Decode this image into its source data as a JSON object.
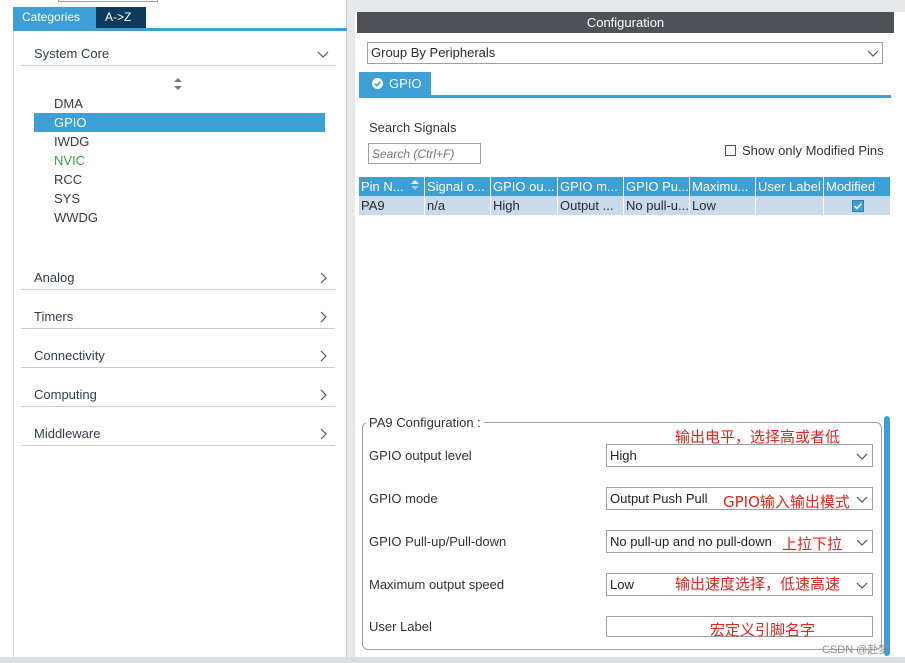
{
  "left": {
    "tabs": {
      "categories": "Categories",
      "az": "A->Z"
    },
    "groups": {
      "system_core": "System Core",
      "analog": "Analog",
      "timers": "Timers",
      "connectivity": "Connectivity",
      "computing": "Computing",
      "middleware": "Middleware"
    },
    "core_items": [
      "DMA",
      "GPIO",
      "IWDG",
      "NVIC",
      "RCC",
      "SYS",
      "WWDG"
    ],
    "selected_item": "GPIO"
  },
  "right": {
    "title": "Configuration",
    "group_select": "Group By Peripherals",
    "tab_gpio": "GPIO",
    "search_label": "Search Signals",
    "search_placeholder": "Search (Ctrl+F)",
    "show_modified": "Show only Modified Pins",
    "table": {
      "headers": [
        "Pin N...",
        "Signal o...",
        "GPIO ou...",
        "GPIO m...",
        "GPIO Pu...",
        "Maximu...",
        "User Label",
        "Modified"
      ],
      "rows": [
        [
          "PA9",
          "n/a",
          "High",
          "Output ...",
          "No pull-u...",
          "Low",
          "",
          ""
        ]
      ],
      "modified_checked": true
    },
    "pin_config": {
      "legend": "PA9 Configuration :",
      "rows": [
        {
          "label": "GPIO output level",
          "value": "High"
        },
        {
          "label": "GPIO mode",
          "value": "Output Push Pull"
        },
        {
          "label": "GPIO Pull-up/Pull-down",
          "value": "No pull-up and no pull-down"
        },
        {
          "label": "Maximum output speed",
          "value": "Low"
        },
        {
          "label": "User Label",
          "value": ""
        }
      ]
    },
    "notes": {
      "output_level": "输出电平，选择高或者低",
      "mode": "GPIO输入输出模式",
      "pull": "上拉下拉",
      "speed": "输出速度选择，低速高速",
      "user_label": "宏定义引脚名字"
    }
  },
  "watermark": "CSDN @赴梦",
  "colors": {
    "accent": "#3c9fd6",
    "dark_tab": "#0e3a5d",
    "title_bar": "#4e5257",
    "row_bg": "#c9daeb",
    "note": "#e0261f",
    "nvic": "#3aa14a"
  }
}
